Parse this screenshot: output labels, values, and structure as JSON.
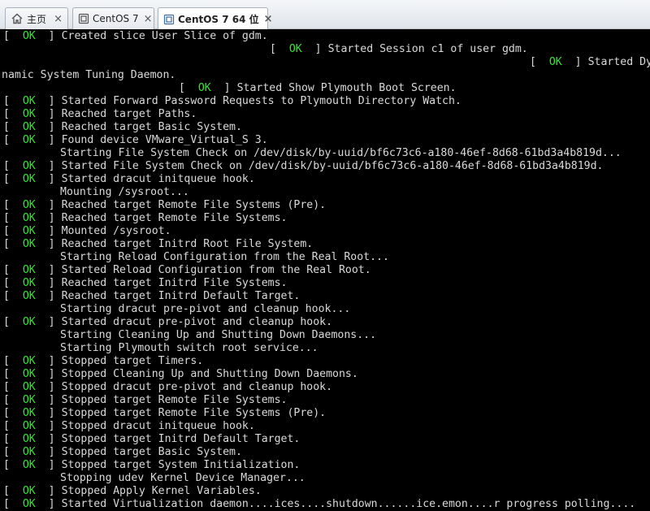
{
  "tabs": [
    {
      "label": "主页",
      "icon": "home-icon",
      "active": false
    },
    {
      "label": "CentOS 7",
      "icon": "vm-icon",
      "active": false
    },
    {
      "label": "CentOS 7 64 位",
      "icon": "vm-icon",
      "active": true
    }
  ],
  "tab_close_glyph": "×",
  "status": {
    "ok_text": "OK",
    "open": "[ ",
    "close": " ]"
  },
  "console_lines": [
    {
      "ok": true,
      "text": "Created slice User Slice of gdm."
    },
    {
      "ok": true,
      "text": "Started Session c1 of user gdm."
    },
    {
      "ok": true,
      "text": "Started Dy"
    },
    {
      "ok": false,
      "text": "namic System Tuning Daemon."
    },
    {
      "ok": true,
      "text": "Started Show Plymouth Boot Screen."
    },
    {
      "ok": true,
      "text": "Started Forward Password Requests to Plymouth Directory Watch."
    },
    {
      "ok": true,
      "text": "Reached target Paths."
    },
    {
      "ok": true,
      "text": "Reached target Basic System."
    },
    {
      "ok": true,
      "text": "Found device VMware_Virtual_S 3."
    },
    {
      "ok": false,
      "text": "Starting File System Check on /dev/disk/by-uuid/bf6c73c6-a180-46ef-8d68-61bd3a4b819d..."
    },
    {
      "ok": true,
      "text": "Started File System Check on /dev/disk/by-uuid/bf6c73c6-a180-46ef-8d68-61bd3a4b819d."
    },
    {
      "ok": true,
      "text": "Started dracut initqueue hook."
    },
    {
      "ok": false,
      "text": "Mounting /sysroot..."
    },
    {
      "ok": true,
      "text": "Reached target Remote File Systems (Pre)."
    },
    {
      "ok": true,
      "text": "Reached target Remote File Systems."
    },
    {
      "ok": true,
      "text": "Mounted /sysroot."
    },
    {
      "ok": true,
      "text": "Reached target Initrd Root File System."
    },
    {
      "ok": false,
      "text": "Starting Reload Configuration from the Real Root..."
    },
    {
      "ok": true,
      "text": "Started Reload Configuration from the Real Root."
    },
    {
      "ok": true,
      "text": "Reached target Initrd File Systems."
    },
    {
      "ok": true,
      "text": "Reached target Initrd Default Target."
    },
    {
      "ok": false,
      "text": "Starting dracut pre-pivot and cleanup hook..."
    },
    {
      "ok": true,
      "text": "Started dracut pre-pivot and cleanup hook."
    },
    {
      "ok": false,
      "text": "Starting Cleaning Up and Shutting Down Daemons..."
    },
    {
      "ok": false,
      "text": "Starting Plymouth switch root service..."
    },
    {
      "ok": true,
      "text": "Stopped target Timers."
    },
    {
      "ok": true,
      "text": "Stopped Cleaning Up and Shutting Down Daemons."
    },
    {
      "ok": true,
      "text": "Stopped dracut pre-pivot and cleanup hook."
    },
    {
      "ok": true,
      "text": "Stopped target Remote File Systems."
    },
    {
      "ok": true,
      "text": "Stopped target Remote File Systems (Pre)."
    },
    {
      "ok": true,
      "text": "Stopped dracut initqueue hook."
    },
    {
      "ok": true,
      "text": "Stopped target Initrd Default Target."
    },
    {
      "ok": true,
      "text": "Stopped target Basic System."
    },
    {
      "ok": true,
      "text": "Stopped target System Initialization."
    },
    {
      "ok": false,
      "text": "Stopping udev Kernel Device Manager..."
    },
    {
      "ok": true,
      "text": "Stopped Apply Kernel Variables."
    },
    {
      "ok": true,
      "text": "Started Virtualization daemon....ices....shutdown......ice.emon....r progress polling...."
    }
  ]
}
